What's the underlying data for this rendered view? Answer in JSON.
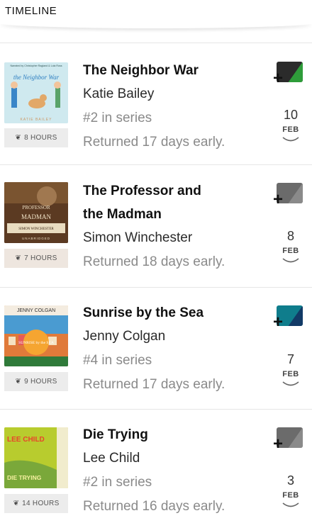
{
  "header": {
    "title": "TIMELINE"
  },
  "entries": [
    {
      "title_line1": "The Neighbor War",
      "title_line2": "",
      "author": "Katie Bailey",
      "series": "#2 in series",
      "status": "Returned 17 days early.",
      "hours": "8 HOURS",
      "day": "10",
      "month": "FEB",
      "cover_text": {
        "top": "Narrated by Christopher Ragland & Lola Ross",
        "title": "the Neighbor War",
        "author": "KATIE BAILEY"
      },
      "colors": {
        "cover": "#cfe9ef",
        "hours_bg": "#ececec",
        "tag_left": "#2b2b2b",
        "tag_right": "#2e9c3a"
      }
    },
    {
      "title_line1": "The Professor and",
      "title_line2": "the Madman",
      "author": "Simon Winchester",
      "series": "",
      "status": "Returned 18 days early.",
      "hours": "7 HOURS",
      "day": "8",
      "month": "FEB",
      "cover_text": {
        "title": "PROFESSOR",
        "subtitle": "MADMAN",
        "author": "SIMON WINCHESTER",
        "bottom": "UNABRIDGED"
      },
      "colors": {
        "cover": "#5b3a22",
        "hours_bg": "#eee6df",
        "tag_left": "#6b6b6b",
        "tag_right": "#8a8a8a"
      }
    },
    {
      "title_line1": "Sunrise by the Sea",
      "title_line2": "",
      "author": "Jenny Colgan",
      "series": "#4 in series",
      "status": "Returned 17 days early.",
      "hours": "9 HOURS",
      "day": "7",
      "month": "FEB",
      "cover_text": {
        "top": "JENNY COLGAN",
        "title": "SUNRISE by the SEA"
      },
      "colors": {
        "cover": "#f5a531",
        "hours_bg": "#ececec",
        "tag_left": "#0f7d8c",
        "tag_right": "#123a66"
      }
    },
    {
      "title_line1": "Die Trying",
      "title_line2": "",
      "author": "Lee Child",
      "series": "#2 in series",
      "status": "Returned 16 days early.",
      "hours": "14 HOURS",
      "day": "3",
      "month": "FEB",
      "cover_text": {
        "top": "LEE CHILD",
        "title": "DIE TRYING"
      },
      "colors": {
        "cover": "#b8cc2e",
        "hours_bg": "#ececec",
        "tag_left": "#6b6b6b",
        "tag_right": "#8a8a8a"
      }
    }
  ]
}
